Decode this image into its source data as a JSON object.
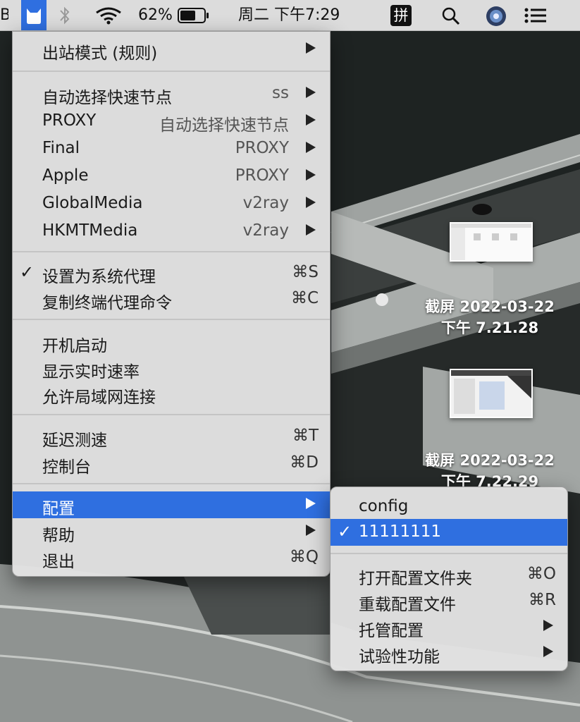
{
  "menubar": {
    "left_fragment": "B",
    "battery_percent": "62%",
    "clock": "周二 下午7:29",
    "input_method": "拼"
  },
  "main_menu": {
    "outbound_mode": "出站模式 (规则)",
    "groups": [
      {
        "label": "自动选择快速节点",
        "value": "ss"
      },
      {
        "label": "PROXY",
        "value": "自动选择快速节点"
      },
      {
        "label": "Final",
        "value": "PROXY"
      },
      {
        "label": "Apple",
        "value": "PROXY"
      },
      {
        "label": "GlobalMedia",
        "value": "v2ray"
      },
      {
        "label": "HKMTMedia",
        "value": "v2ray"
      }
    ],
    "set_system_proxy": {
      "label": "设置为系统代理",
      "checkmark": "✓",
      "shortcut": "⌘S"
    },
    "copy_terminal_cmd": {
      "label": "复制终端代理命令",
      "shortcut": "⌘C"
    },
    "launch_at_login": "开机启动",
    "show_speed": "显示实时速率",
    "allow_lan": "允许局域网连接",
    "latency_test": {
      "label": "延迟测速",
      "shortcut": "⌘T"
    },
    "dashboard": {
      "label": "控制台",
      "shortcut": "⌘D"
    },
    "config": "配置",
    "help": "帮助",
    "quit": {
      "label": "退出",
      "shortcut": "⌘Q"
    }
  },
  "config_submenu": {
    "items": [
      {
        "label": "config"
      },
      {
        "label": "11111111",
        "checkmark": "✓"
      }
    ],
    "open_folder": {
      "label": "打开配置文件夹",
      "shortcut": "⌘O"
    },
    "reload": {
      "label": "重载配置文件",
      "shortcut": "⌘R"
    },
    "managed": "托管配置",
    "experimental": "试验性功能"
  },
  "desktop_files": [
    {
      "line1": "截屏 2022-03-22",
      "line2": "下午 7.21.28"
    },
    {
      "line1": "截屏 2022-03-22",
      "line2": "下午 7.22.29"
    }
  ],
  "colors": {
    "highlight": "#2f6fe0",
    "menu_bg": "#e2e2e2",
    "menubar_bg": "#dcdcdc"
  }
}
